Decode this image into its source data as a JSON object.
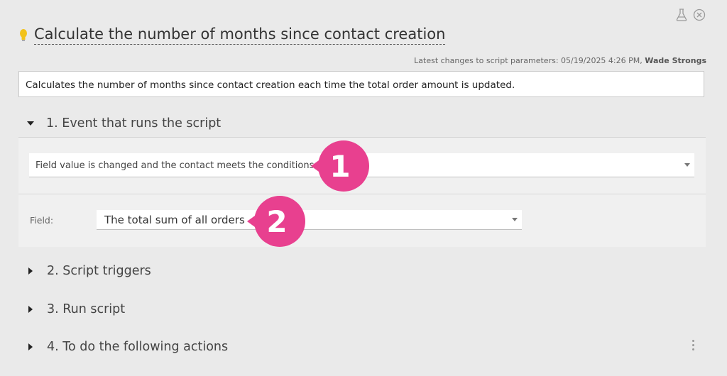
{
  "header": {
    "title": "Calculate the number of months since contact creation",
    "changes_prefix": "Latest changes to script parameters: 05/19/2025 4:26 PM, ",
    "changes_user": "Wade Strongs"
  },
  "description": "Calculates the number of months since contact creation each time the total order amount is updated.",
  "sections": [
    {
      "label": "1. Event that runs the script",
      "expanded": true
    },
    {
      "label": "2. Script triggers",
      "expanded": false
    },
    {
      "label": "3. Run script",
      "expanded": false
    },
    {
      "label": "4. To do the following actions",
      "expanded": false
    }
  ],
  "event": {
    "selected": "Field value is changed and the contact meets the conditions",
    "field_label": "Field:",
    "field_value": "The total sum of all orders"
  },
  "callouts": [
    "1",
    "2"
  ],
  "colors": {
    "callout": "#e8408f",
    "bulb": "#f2c21a",
    "background": "#eaeaea"
  },
  "icons": [
    "bulb-icon",
    "flask-icon",
    "close-icon",
    "chevron-down-icon",
    "kebab-menu-icon"
  ]
}
